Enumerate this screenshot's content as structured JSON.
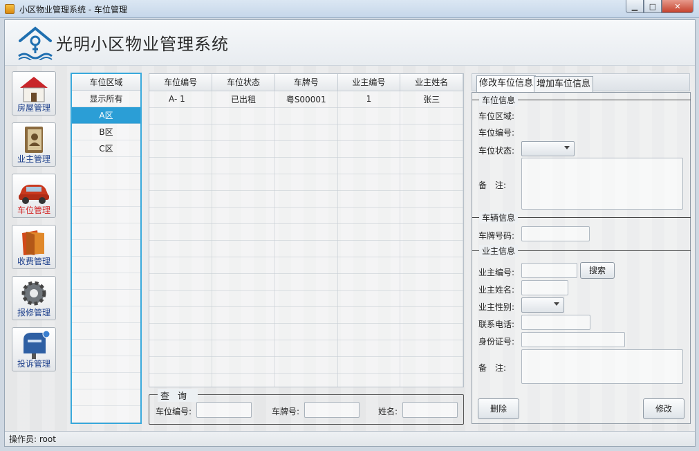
{
  "window": {
    "title": "小区物业管理系统 - 车位管理"
  },
  "header": {
    "app_name": "光明小区物业管理系统"
  },
  "nav": [
    {
      "label": "房屋管理",
      "icon": "house-icon"
    },
    {
      "label": "业主管理",
      "icon": "address-book-icon"
    },
    {
      "label": "车位管理",
      "icon": "car-icon",
      "active": true
    },
    {
      "label": "收费管理",
      "icon": "wallet-icon"
    },
    {
      "label": "报修管理",
      "icon": "gear-icon"
    },
    {
      "label": "投诉管理",
      "icon": "mailbox-icon"
    }
  ],
  "area_list": {
    "header": "车位区域",
    "items": [
      "显示所有",
      "A区",
      "B区",
      "C区"
    ],
    "selected": "A区"
  },
  "grid": {
    "columns": [
      "车位编号",
      "车位状态",
      "车牌号",
      "业主编号",
      "业主姓名"
    ],
    "rows": [
      [
        "A- 1",
        "已出租",
        "粤S00001",
        "1",
        "张三"
      ]
    ]
  },
  "query": {
    "legend": "查询",
    "space_no_label": "车位编号:",
    "plate_label": "车牌号:",
    "name_label": "姓名:",
    "space_no_value": "",
    "plate_value": "",
    "name_value": ""
  },
  "right": {
    "tabs": [
      "修改车位信息",
      "增加车位信息"
    ],
    "active_tab": "修改车位信息",
    "space_section": {
      "legend": "车位信息",
      "area_label": "车位区域:",
      "number_label": "车位编号:",
      "status_label": "车位状态:",
      "remark_label": "备　注:",
      "area_value": "",
      "number_value": "",
      "status_value": "",
      "remark_value": ""
    },
    "vehicle_section": {
      "legend": "车辆信息",
      "plate_label": "车牌号码:",
      "plate_value": ""
    },
    "owner_section": {
      "legend": "业主信息",
      "owner_no_label": "业主编号:",
      "search_button": "搜索",
      "owner_name_label": "业主姓名:",
      "gender_label": "业主性别:",
      "phone_label": "联系电话:",
      "id_label": "身份证号:",
      "remark_label": "备　注:",
      "owner_no_value": "",
      "owner_name_value": "",
      "gender_value": "",
      "phone_value": "",
      "id_value": "",
      "remark_value": ""
    },
    "delete_button": "删除",
    "modify_button": "修改"
  },
  "statusbar": {
    "operator": "操作员: root"
  }
}
